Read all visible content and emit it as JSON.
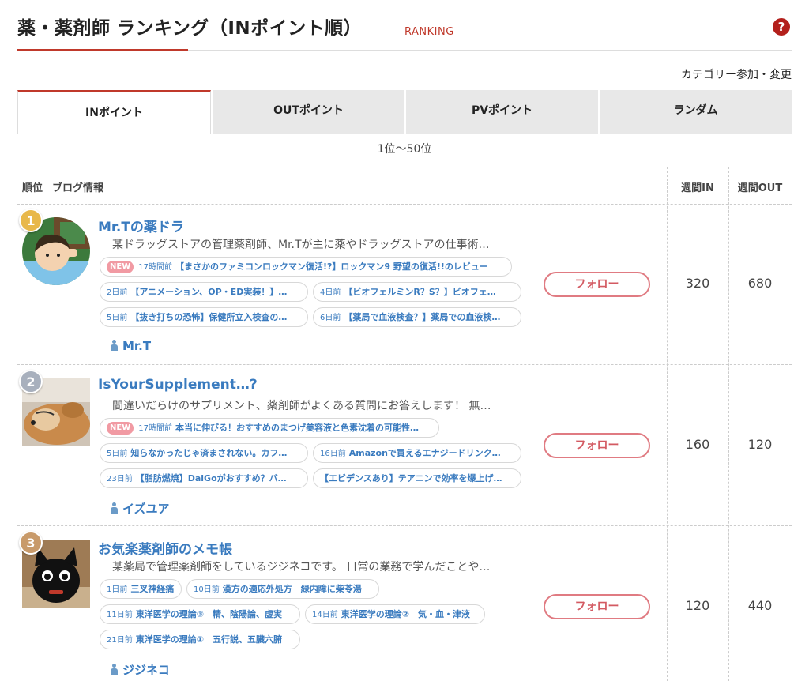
{
  "header": {
    "title": "薬・薬剤師 ランキング（INポイント順）",
    "sub": "RANKING",
    "help": "?"
  },
  "category_link": "カテゴリー参加・変更",
  "tabs": [
    "INポイント",
    "OUTポイント",
    "PVポイント",
    "ランダム"
  ],
  "range": "1位〜50位",
  "table_head": {
    "rank": "順位",
    "blog": "ブログ情報",
    "week_in": "週間IN",
    "week_out": "週間OUT"
  },
  "follow_label": "フォロー",
  "new_label": "NEW",
  "entries": [
    {
      "rank": "1",
      "title": "Mr.Tの薬ドラ",
      "desc": "某ドラッグストアの管理薬剤師、Mr.Tが主に薬やドラッグストアの仕事術…",
      "posts": [
        {
          "ago": "17時間前",
          "text": "【まさかのファミコンロックマン復活!?】ロックマン9 野望の復活!!のレビュー",
          "new": true
        },
        {
          "ago": "2日前",
          "text": "【アニメーション、OP・ED実装！】…"
        },
        {
          "ago": "4日前",
          "text": "【ビオフェルミンR？S？】ビオフェ…"
        },
        {
          "ago": "5日前",
          "text": "【抜き打ちの恐怖】保健所立入検査の…"
        },
        {
          "ago": "6日前",
          "text": "【薬局で血液検査？】薬局での血液検…"
        }
      ],
      "author": "Mr.T",
      "week_in": "320",
      "week_out": "680"
    },
    {
      "rank": "2",
      "title": "IsYourSupplement…?",
      "desc": "間違いだらけのサプリメント、薬剤師がよくある質問にお答えします！ 無…",
      "posts": [
        {
          "ago": "17時間前",
          "text": "本当に伸びる！おすすめのまつげ美容液と色素沈着の可能性…",
          "new": true
        },
        {
          "ago": "5日前",
          "text": "知らなかったじゃ済まされない。カフ…"
        },
        {
          "ago": "16日前",
          "text": "Amazonで買えるエナジードリンク…"
        },
        {
          "ago": "23日前",
          "text": "【脂肪燃焼】DaiGoがおすすめ？バ…"
        },
        {
          "ago": "",
          "text": "【エビデンスあり】テアニンで効率を爆上げ…"
        }
      ],
      "author": "イズユア",
      "week_in": "160",
      "week_out": "120"
    },
    {
      "rank": "3",
      "title": "お気楽薬剤師のメモ帳",
      "desc": "某薬局で管理薬剤師をしているジジネコです。 日常の業務で学んだことや…",
      "posts": [
        {
          "ago": "1日前",
          "text": "三叉神経痛"
        },
        {
          "ago": "10日前",
          "text": "漢方の適応外処方　緑内障に柴苓湯"
        },
        {
          "ago": "11日前",
          "text": "東洋医学の理論③　精、陰陽論、虚実"
        },
        {
          "ago": "14日前",
          "text": "東洋医学の理論②　気・血・津液"
        },
        {
          "ago": "21日前",
          "text": "東洋医学の理論①　五行説、五臓六腑"
        }
      ],
      "author": "ジジネコ",
      "week_in": "120",
      "week_out": "440"
    }
  ],
  "colors": {
    "accent": "#c0392b",
    "link": "#3a7bbf",
    "follow": "#e07b82",
    "gold": "#e8b84a",
    "silver": "#a8b0bd",
    "bronze": "#c89a6a"
  },
  "icons": {
    "help": "help-icon",
    "author": "person-icon"
  }
}
